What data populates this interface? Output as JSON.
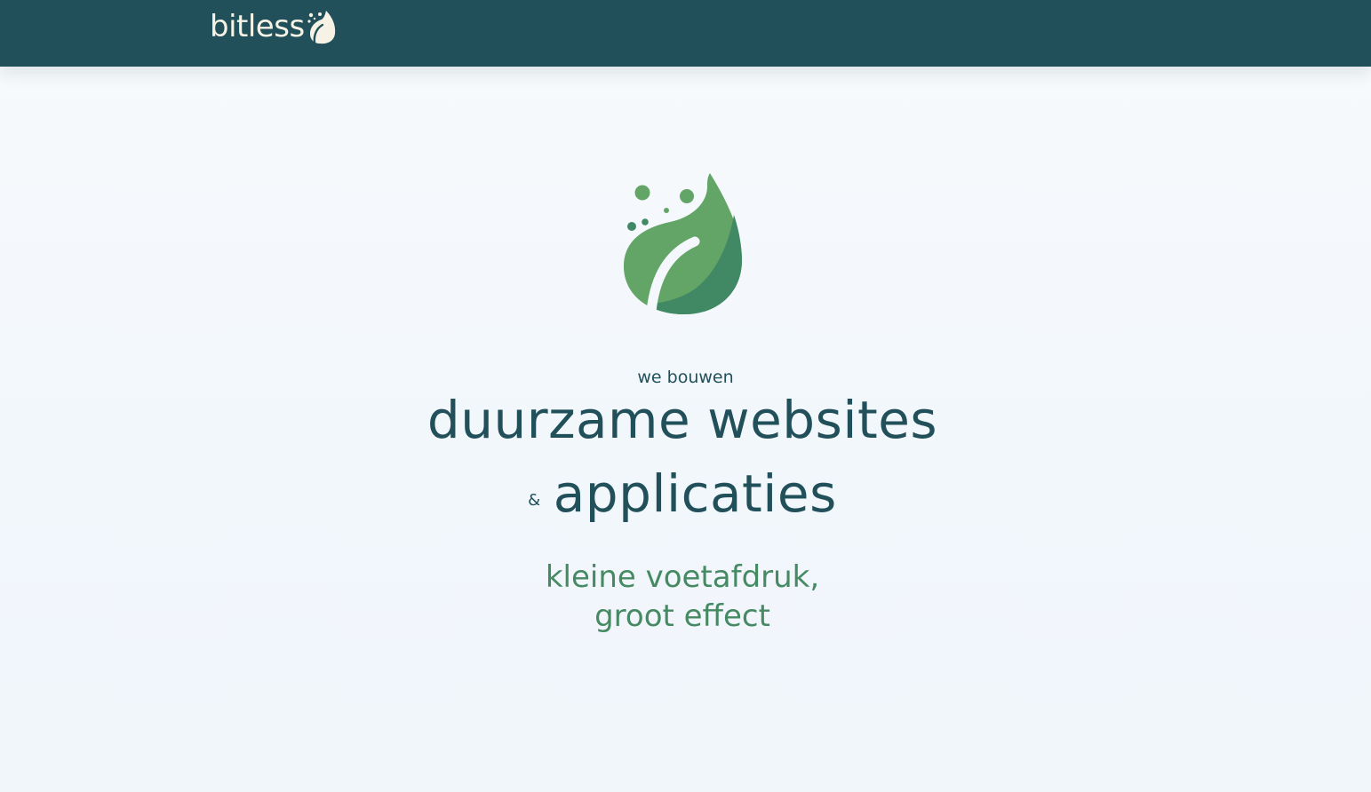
{
  "header": {
    "brand_name": "bitless",
    "logo_icon": "leaf-icon",
    "background_color": "#21505a",
    "brand_text_color": "#f6f3e6"
  },
  "hero": {
    "logo_icon": "leaf-bubbles-icon",
    "eyebrow": "we bouwen",
    "headline_line1": "duurzame websites",
    "ampersand": "&",
    "headline_line2": "applicaties",
    "tagline_line1": "kleine voetafdruk,",
    "tagline_line2": "groot effect",
    "colors": {
      "text_dark": "#21505a",
      "accent_green": "#468a64",
      "leaf_light": "#63a566",
      "leaf_dark": "#418865"
    }
  }
}
